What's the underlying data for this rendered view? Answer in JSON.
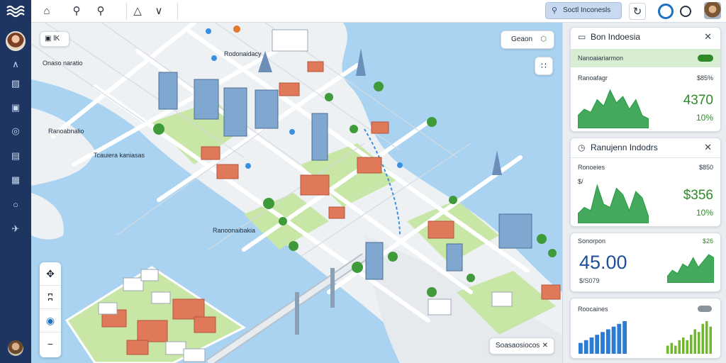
{
  "colors": {
    "rail": "#1d3560",
    "water": "#a9d3f1",
    "land": "#eef1f4",
    "park": "#c8e6a6",
    "road": "#ffffff",
    "accent_blue": "#1f6fc2",
    "accent_green": "#2f8a2a",
    "chart_green": "#239a3f",
    "chart_blue": "#2a7bd4"
  },
  "rail": {
    "logo_icon": "waves-logo-icon",
    "items": [
      {
        "name": "collapse",
        "icon": "chevron-up-icon"
      },
      {
        "name": "layers",
        "icon": "layers-icon"
      },
      {
        "name": "briefcase",
        "icon": "briefcase-icon"
      },
      {
        "name": "compass",
        "icon": "compass-icon"
      },
      {
        "name": "clipboard",
        "icon": "clipboard-icon"
      },
      {
        "name": "gallery",
        "icon": "gallery-icon"
      },
      {
        "name": "globe",
        "icon": "globe-icon"
      },
      {
        "name": "plane",
        "icon": "plane-icon"
      }
    ]
  },
  "topbar": {
    "icons": [
      "home-icon",
      "search-icon",
      "search-icon",
      "shapes-icon",
      "chevron-down-icon"
    ],
    "search_label": "Soctl Inconesls",
    "right_icons": [
      "refresh-icon",
      "record-icon",
      "circle-icon"
    ]
  },
  "map": {
    "labels": [
      {
        "id": "label-1",
        "text": "Onaso naratio"
      },
      {
        "id": "label-2",
        "text": "Rodonaidacy"
      },
      {
        "id": "label-3",
        "text": "Ranoabnalio"
      },
      {
        "id": "label-4",
        "text": "Tcauiera kaniasas"
      },
      {
        "id": "label-5",
        "text": "Ranoonaibakia"
      }
    ],
    "toolbar_left": {
      "icon": "map-icon",
      "text": "lK"
    },
    "top_card": {
      "text": "Geaon"
    },
    "bottom_card": {
      "text": "Soasaosiocos"
    },
    "zoom_tools": [
      "move-icon",
      "pin-tool-icon",
      "eye-icon",
      "minus-icon"
    ]
  },
  "panel": {
    "cards": [
      {
        "title": "Bon Indoesia",
        "banner": "Nanoaiariarmon",
        "label_left": "Ranoafagr",
        "label_right": "$85%",
        "value": "4370",
        "pct": "10%"
      },
      {
        "title": "Ranujenn Indodrs",
        "label_left": "Ronoeies",
        "label_right": "$850",
        "label_mid": "$/",
        "value": "$356",
        "pct": "10%"
      },
      {
        "label_left": "Sonorpon",
        "label_right": "$26",
        "value": "45.00",
        "sub": "$/S079"
      },
      {
        "label_left": "Roocaines"
      }
    ]
  },
  "chart_data": [
    {
      "type": "area",
      "name": "card-1-trend",
      "values": [
        4,
        6,
        5,
        9,
        7,
        12,
        8,
        10,
        6,
        9,
        4,
        3
      ]
    },
    {
      "type": "area",
      "name": "card-2-trend",
      "values": [
        3,
        5,
        4,
        12,
        6,
        5,
        11,
        9,
        4,
        10,
        8,
        2
      ]
    },
    {
      "type": "area",
      "name": "card-3-trend",
      "values": [
        2,
        4,
        3,
        6,
        5,
        8,
        5,
        7,
        9,
        8
      ]
    },
    {
      "type": "bar",
      "name": "card-4-blue-bars",
      "values": [
        4,
        5,
        6,
        7,
        8,
        9,
        10,
        11,
        12
      ]
    },
    {
      "type": "bar",
      "name": "card-4-green-bars",
      "values": [
        3,
        4,
        3,
        5,
        6,
        5,
        7,
        9,
        8,
        11,
        12,
        10
      ]
    }
  ]
}
